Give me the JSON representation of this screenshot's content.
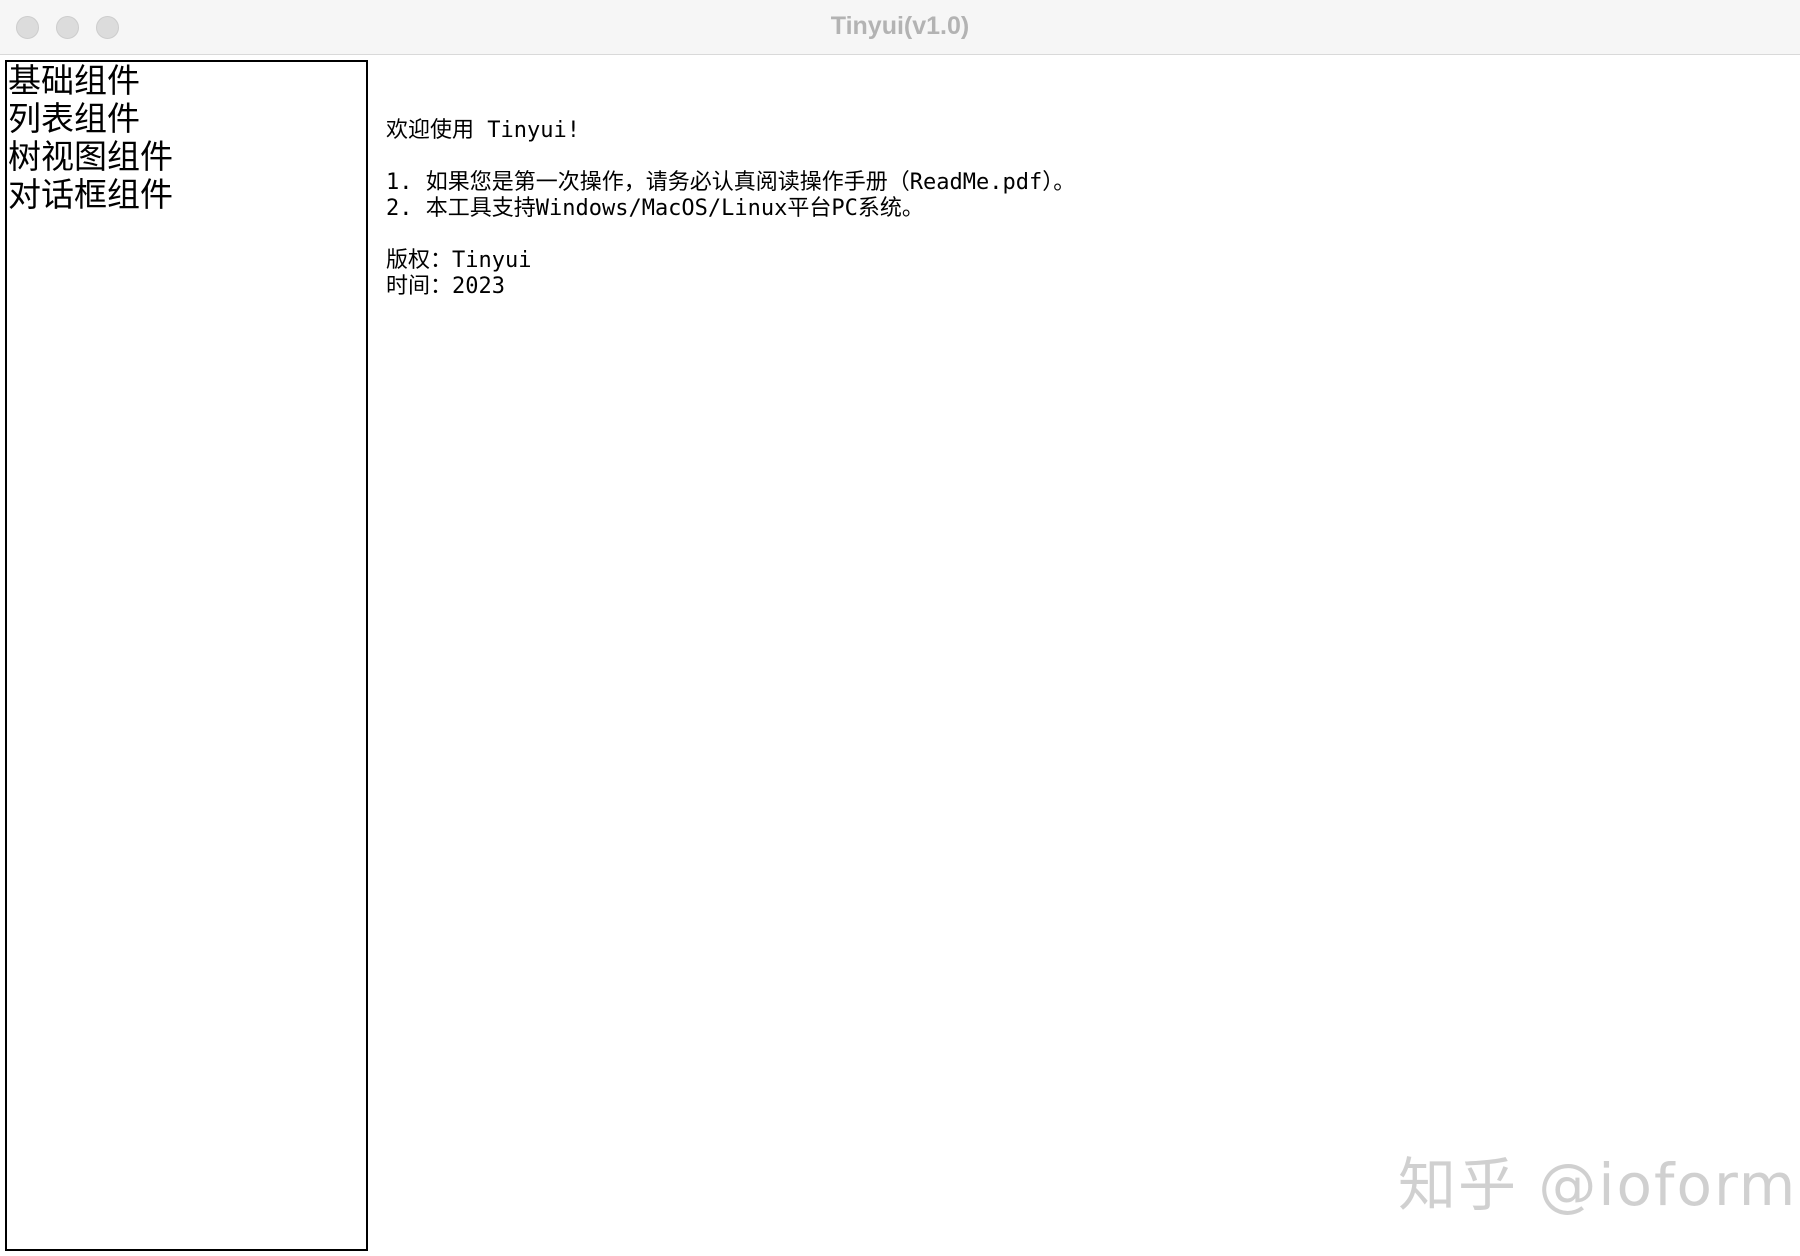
{
  "window": {
    "title": "Tinyui(v1.0)"
  },
  "sidebar": {
    "items": [
      {
        "label": "基础组件"
      },
      {
        "label": "列表组件"
      },
      {
        "label": "树视图组件"
      },
      {
        "label": "对话框组件"
      }
    ]
  },
  "content": {
    "welcome": "欢迎使用 Tinyui!",
    "note1": "1. 如果您是第一次操作，请务必认真阅读操作手册（ReadMe.pdf）。",
    "note2": "2. 本工具支持Windows/MacOS/Linux平台PC系统。",
    "copyright": "版权：Tinyui",
    "date": "时间：2023"
  },
  "watermark": {
    "text": "知乎 @ioformo"
  }
}
